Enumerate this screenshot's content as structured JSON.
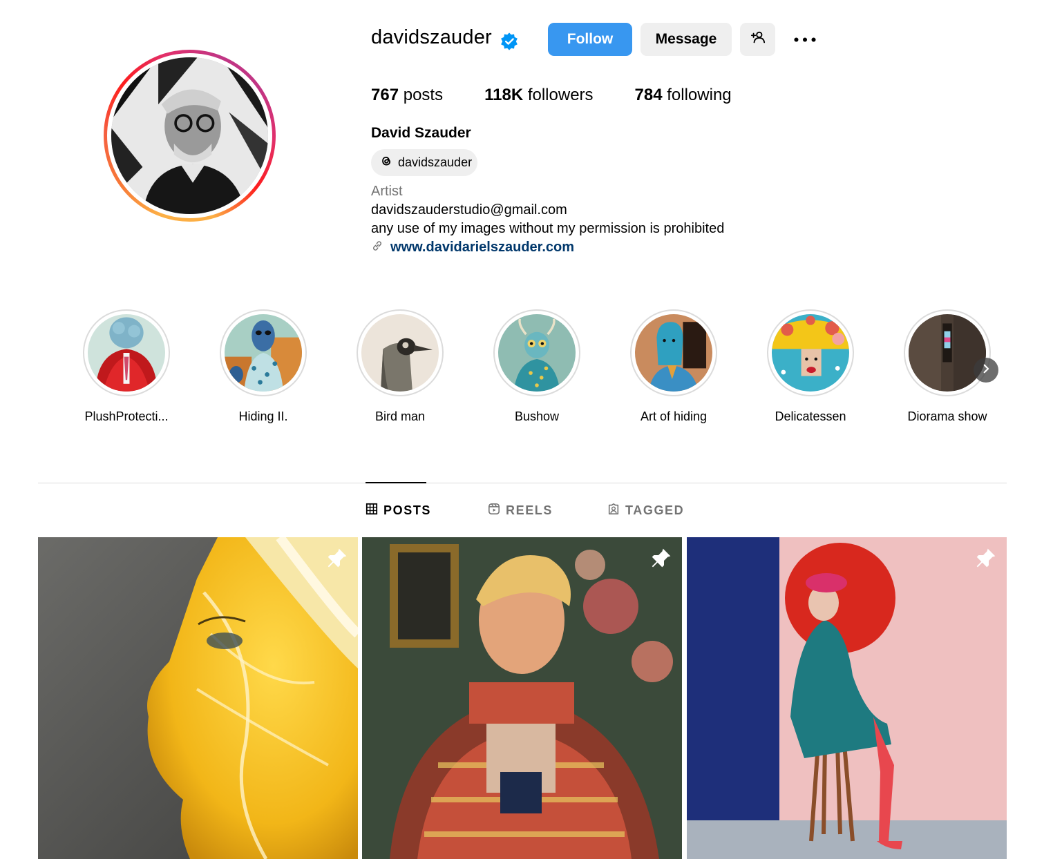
{
  "profile": {
    "username": "davidszauder",
    "verified_icon": "verified-badge-icon",
    "full_name": "David Szauder",
    "threads_handle": "davidszauder",
    "category": "Artist",
    "bio_lines": [
      "davidszauderstudio@gmail.com",
      "any use of my images without my permission is prohibited"
    ],
    "website": "www.davidarielszauder.com"
  },
  "actions": {
    "follow_label": "Follow",
    "message_label": "Message",
    "add_user_icon": "add-user-icon",
    "more_icon": "more-options-icon"
  },
  "stats": {
    "posts_count": "767",
    "posts_label": "posts",
    "followers_count": "118K",
    "followers_label": "followers",
    "following_count": "784",
    "following_label": "following"
  },
  "highlights": [
    {
      "label": "PlushProtecti..."
    },
    {
      "label": "Hiding II."
    },
    {
      "label": "Bird man"
    },
    {
      "label": "Bushow"
    },
    {
      "label": "Art of hiding"
    },
    {
      "label": "Delicatessen"
    },
    {
      "label": "Diorama show"
    }
  ],
  "tabs": [
    {
      "label": "POSTS",
      "icon": "grid-icon",
      "active": true
    },
    {
      "label": "REELS",
      "icon": "reels-icon",
      "active": false
    },
    {
      "label": "TAGGED",
      "icon": "tagged-icon",
      "active": false
    }
  ],
  "posts": [
    {
      "pinned": true
    },
    {
      "pinned": true
    },
    {
      "pinned": true
    }
  ],
  "colors": {
    "follow_button": "#3897f0",
    "secondary_button": "#efefef",
    "link": "#00376b",
    "muted": "#737373"
  }
}
